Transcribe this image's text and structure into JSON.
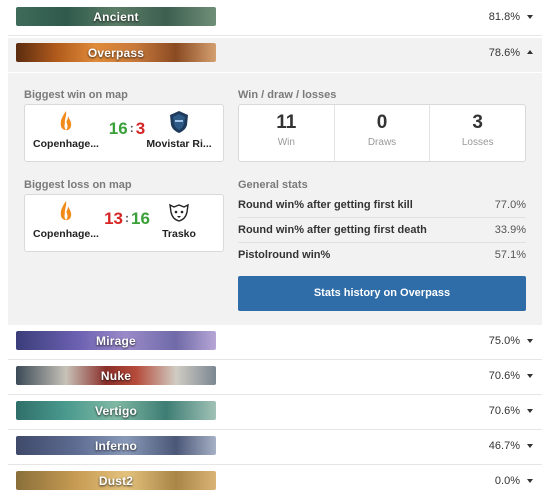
{
  "maps": [
    {
      "key": "ancient",
      "name": "Ancient",
      "winrate": "81.8%"
    },
    {
      "key": "overpass",
      "name": "Overpass",
      "winrate": "78.6%"
    },
    {
      "key": "mirage",
      "name": "Mirage",
      "winrate": "75.0%"
    },
    {
      "key": "nuke",
      "name": "Nuke",
      "winrate": "70.6%"
    },
    {
      "key": "vertigo",
      "name": "Vertigo",
      "winrate": "70.6%"
    },
    {
      "key": "inferno",
      "name": "Inferno",
      "winrate": "46.7%"
    },
    {
      "key": "dust2",
      "name": "Dust2",
      "winrate": "0.0%"
    }
  ],
  "details": {
    "biggest_win": {
      "title": "Biggest win on map",
      "team1": "Copenhage...",
      "team2": "Movistar Ri...",
      "score1": "16",
      "score2": "3"
    },
    "biggest_loss": {
      "title": "Biggest loss on map",
      "team1": "Copenhage...",
      "team2": "Trasko",
      "score1": "13",
      "score2": "16"
    },
    "wdl": {
      "title": "Win / draw / losses",
      "wins": "11",
      "wins_label": "Win",
      "draws": "0",
      "draws_label": "Draws",
      "losses": "3",
      "losses_label": "Losses"
    },
    "general": {
      "title": "General stats",
      "rows": [
        {
          "name": "Round win% after getting first kill",
          "value": "77.0%"
        },
        {
          "name": "Round win% after getting first death",
          "value": "33.9%"
        },
        {
          "name": "Pistolround win%",
          "value": "57.1%"
        }
      ]
    },
    "history_button": "Stats history on Overpass"
  },
  "colors": {
    "win": "#3aa039",
    "loss": "#d62525",
    "button": "#2f6da8",
    "panel": "#f2f2f2"
  },
  "icons": [
    "flame-logo-icon",
    "knight-helmet-logo-icon",
    "bear-logo-icon",
    "caret-down-icon",
    "caret-up-icon"
  ]
}
